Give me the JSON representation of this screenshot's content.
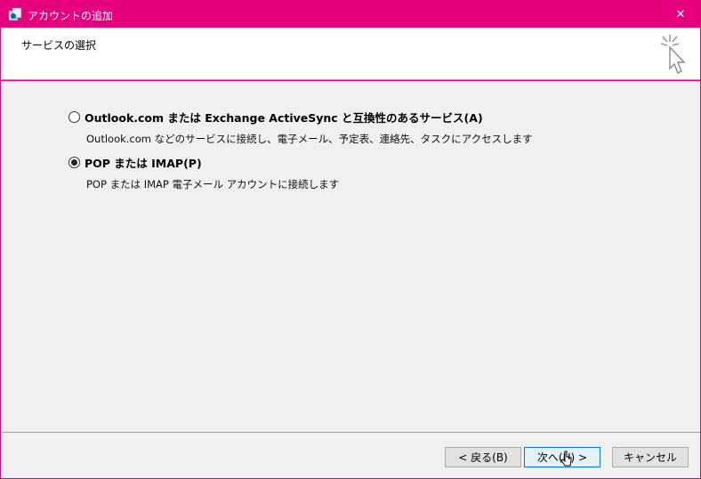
{
  "window": {
    "title": "アカウントの追加",
    "close_glyph": "✕"
  },
  "header": {
    "heading": "サービスの選択"
  },
  "options": [
    {
      "label": "Outlook.com または Exchange ActiveSync と互換性のあるサービス(A)",
      "description": "Outlook.com などのサービスに接続し、電子メール、予定表、連絡先、タスクにアクセスします",
      "checked": false
    },
    {
      "label": "POP または IMAP(P)",
      "description": "POP または IMAP 電子メール アカウントに接続します",
      "checked": true
    }
  ],
  "buttons": {
    "back": "< 戻る(B)",
    "next": "次へ(N) >",
    "cancel": "キャンセル"
  },
  "colors": {
    "titlebar": "#e6007e",
    "accent_button_border": "#0078d7"
  }
}
